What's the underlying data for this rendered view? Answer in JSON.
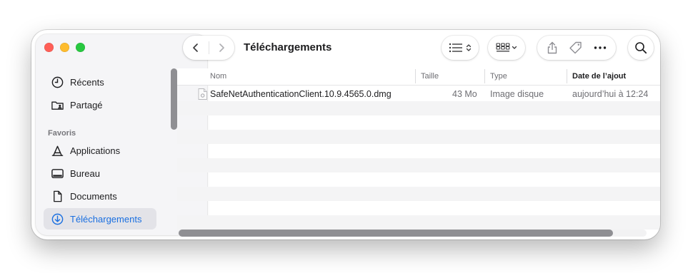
{
  "window": {
    "title": "Téléchargements"
  },
  "colors": {
    "accent": "#1a6fe0",
    "close": "#ff5f57",
    "minimize": "#febc2e",
    "maximize": "#28c840"
  },
  "sidebar": {
    "items_top": [
      {
        "label": "Récents",
        "icon": "clock-icon"
      },
      {
        "label": "Partagé",
        "icon": "shared-folder-icon"
      }
    ],
    "section_label": "Favoris",
    "favorites": [
      {
        "label": "Applications",
        "icon": "applications-icon"
      },
      {
        "label": "Bureau",
        "icon": "desktop-icon"
      },
      {
        "label": "Documents",
        "icon": "document-icon"
      },
      {
        "label": "Téléchargements",
        "icon": "download-icon",
        "selected": true
      }
    ]
  },
  "toolbar": {
    "back": "chevron-left-icon",
    "forward": "chevron-right-icon",
    "view": "list-view-icon",
    "group": "group-icon",
    "share": "share-icon",
    "tag": "tag-icon",
    "more": "more-icon",
    "search": "search-icon"
  },
  "table": {
    "columns": {
      "name": "Nom",
      "size": "Taille",
      "kind": "Type",
      "date_added": "Date de l’ajout"
    },
    "sorted_by": "date_added",
    "files": [
      {
        "name": "SafeNetAuthenticationClient.10.9.4565.0.dmg",
        "size": "43 Mo",
        "kind": "Image disque",
        "date_added": "aujourd’hui à 12:24"
      }
    ]
  }
}
